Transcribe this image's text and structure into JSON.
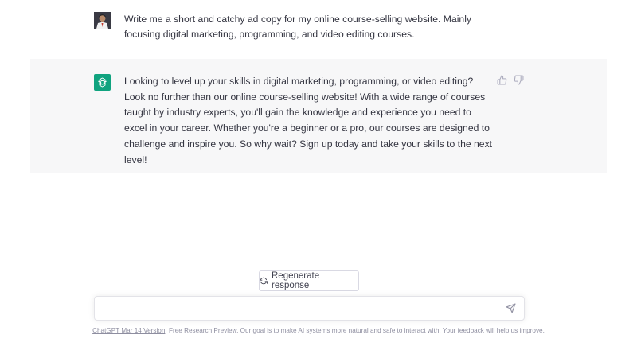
{
  "conversation": {
    "user_message": "Write me a short and catchy ad copy for my online course-selling website. Mainly focusing digital marketing, programming, and video editing courses.",
    "assistant_message": "Looking to level up your skills in digital marketing, programming, or video editing? Look no further than our online course-selling website! With a wide range of courses taught by industry experts, you'll gain the knowledge and experience you need to excel in your career. Whether you're a beginner or a pro, our courses are designed to challenge and inspire you. So why wait? Sign up today and take your skills to the next level!"
  },
  "actions": {
    "regenerate_label": "Regenerate response"
  },
  "composer": {
    "value": "",
    "placeholder": ""
  },
  "footer": {
    "version_link": "ChatGPT Mar 14 Version",
    "disclaimer": ". Free Research Preview. Our goal is to make AI systems more natural and safe to interact with. Your feedback will help us improve."
  },
  "icons": {
    "assistant_avatar": "openai-logo-icon",
    "thumbs_up": "thumbs-up-icon",
    "thumbs_down": "thumbs-down-icon",
    "regenerate": "refresh-icon",
    "send": "send-icon"
  },
  "colors": {
    "accent": "#10a37f",
    "assistant_bg": "#f7f7f8",
    "text": "#343541",
    "muted": "#8e8ea0"
  }
}
